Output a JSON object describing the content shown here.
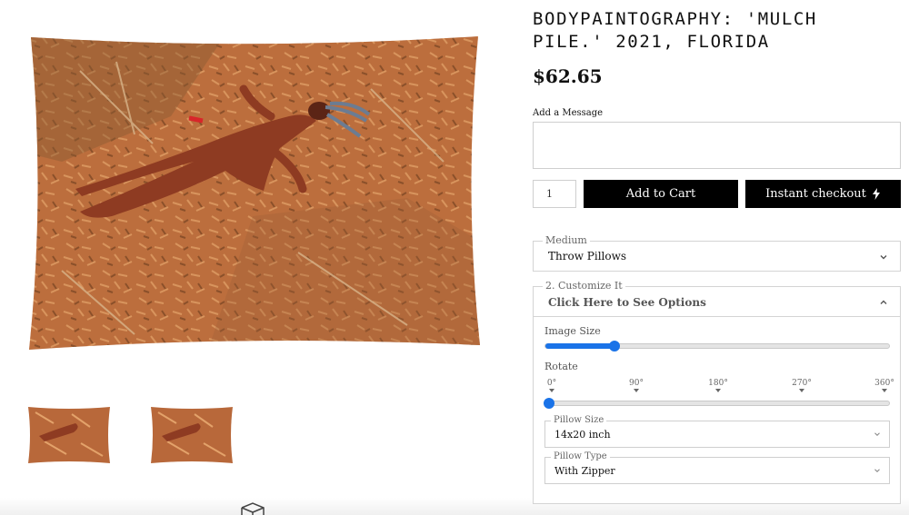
{
  "product": {
    "title": "BODYPAINTOGRAPHY: 'MULCH PILE.' 2021, FLORIDA",
    "price": "$62.65"
  },
  "message": {
    "label": "Add a Message",
    "value": ""
  },
  "purchase": {
    "quantity": "1",
    "add_to_cart_label": "Add to Cart",
    "instant_checkout_label": "Instant checkout",
    "instant_checkout_icon": "lightning-icon",
    "button_color": "#000000"
  },
  "medium": {
    "legend": "Medium",
    "value": "Throw Pillows"
  },
  "customize": {
    "legend": "2. Customize It",
    "toggle_label": "Click Here to See Options",
    "image_size_label": "Image Size",
    "image_size_level": 0.2,
    "rotate_label": "Rotate",
    "rotate_ticks": [
      "0°",
      "90°",
      "180°",
      "270°",
      "360°"
    ],
    "rotate_level": 0,
    "pillow_size_legend": "Pillow Size",
    "pillow_size_value": "14x20 inch",
    "pillow_type_legend": "Pillow Type",
    "pillow_type_value": "With Zipper",
    "slider_color": "#1a73e8"
  },
  "gallery": {
    "thumbnails": [
      "pillow-thumbnail-front",
      "pillow-thumbnail-alt"
    ],
    "ar_icon": "ar-view-icon"
  }
}
